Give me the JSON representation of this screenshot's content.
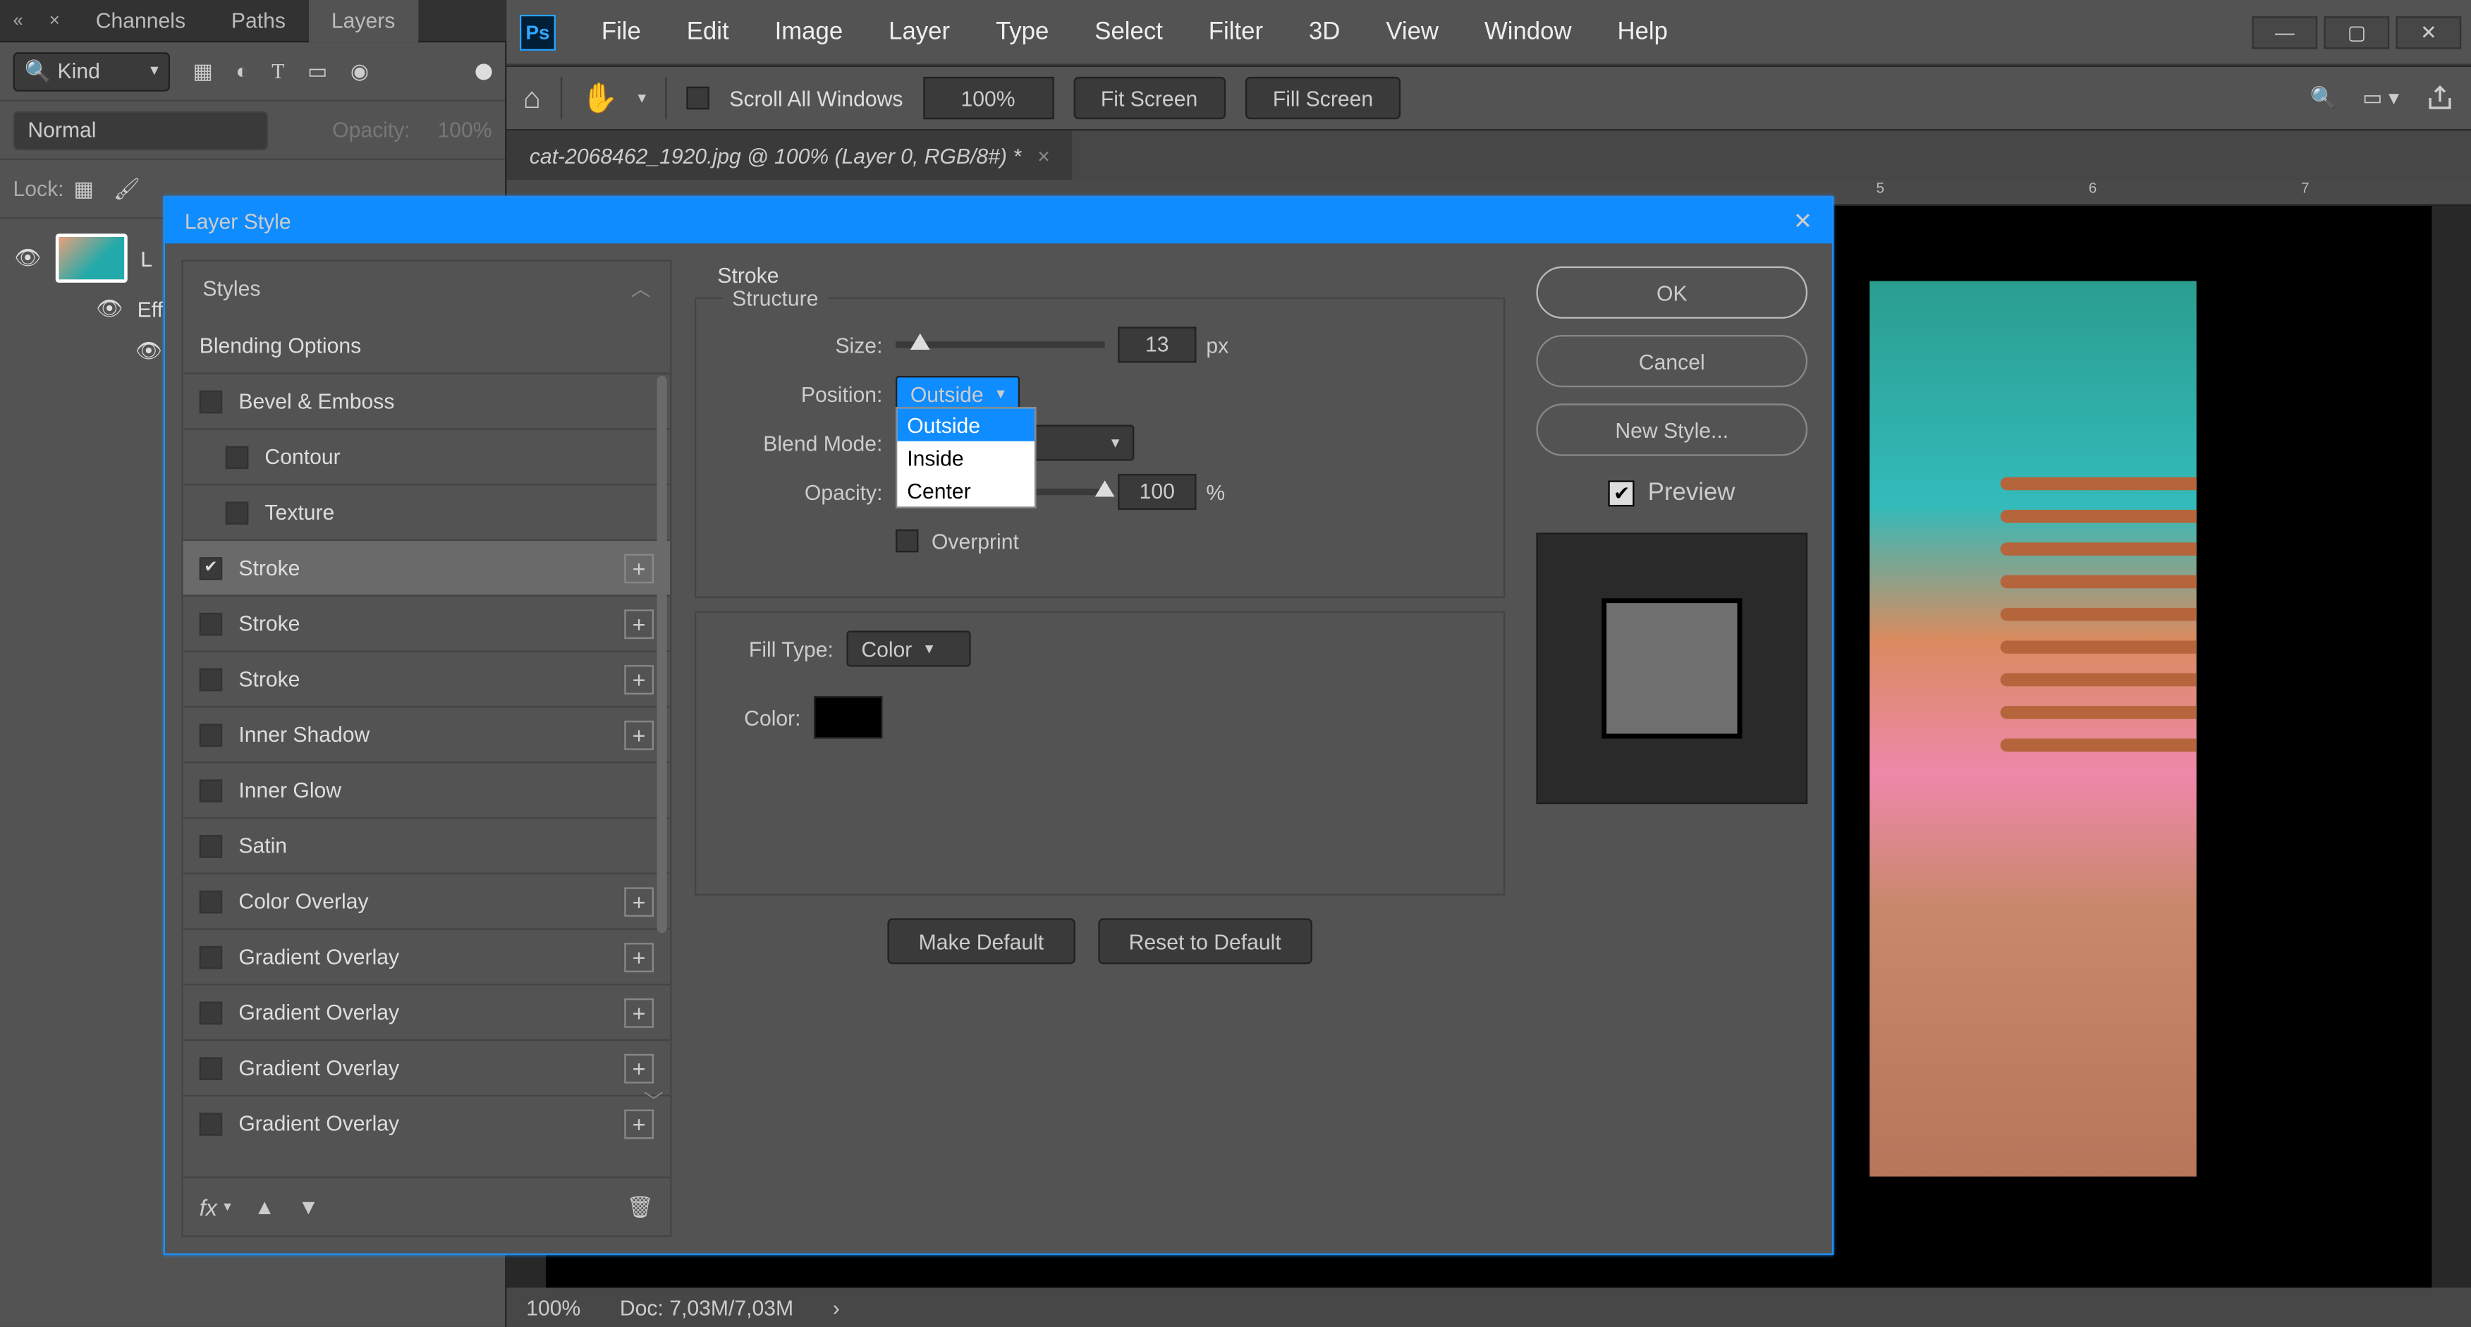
{
  "panel": {
    "tabs": [
      "Channels",
      "Paths",
      "Layers"
    ],
    "active_tab": 2,
    "kind_label": "Kind",
    "blend_mode": "Normal",
    "opacity_label": "Opacity:",
    "opacity_value": "100%",
    "lock_label": "Lock:",
    "layer0": "L",
    "effects_label": "Eff"
  },
  "menu": {
    "items": [
      "File",
      "Edit",
      "Image",
      "Layer",
      "Type",
      "Select",
      "Filter",
      "3D",
      "View",
      "Window",
      "Help"
    ]
  },
  "options": {
    "scroll_all": "Scroll All Windows",
    "zoom": "100%",
    "fit": "Fit Screen",
    "fill": "Fill Screen"
  },
  "document": {
    "tab_title": "cat-2068462_1920.jpg @ 100% (Layer 0, RGB/8#) *"
  },
  "ruler": {
    "ticks": [
      "5",
      "6",
      "7"
    ],
    "positions": [
      838,
      968,
      1098
    ]
  },
  "status": {
    "zoom": "100%",
    "doc": "Doc: 7,03M/7,03M"
  },
  "dialog": {
    "title": "Layer Style",
    "styles_header": "Styles",
    "blending_options": "Blending Options",
    "style_items": [
      {
        "label": "Bevel & Emboss",
        "checked": false,
        "plus": false,
        "indent": false
      },
      {
        "label": "Contour",
        "checked": false,
        "plus": false,
        "indent": true
      },
      {
        "label": "Texture",
        "checked": false,
        "plus": false,
        "indent": true
      },
      {
        "label": "Stroke",
        "checked": true,
        "plus": true,
        "indent": false,
        "selected": true
      },
      {
        "label": "Stroke",
        "checked": false,
        "plus": true,
        "indent": false
      },
      {
        "label": "Stroke",
        "checked": false,
        "plus": true,
        "indent": false
      },
      {
        "label": "Inner Shadow",
        "checked": false,
        "plus": true,
        "indent": false
      },
      {
        "label": "Inner Glow",
        "checked": false,
        "plus": false,
        "indent": false
      },
      {
        "label": "Satin",
        "checked": false,
        "plus": false,
        "indent": false
      },
      {
        "label": "Color Overlay",
        "checked": false,
        "plus": true,
        "indent": false
      },
      {
        "label": "Gradient Overlay",
        "checked": false,
        "plus": true,
        "indent": false
      },
      {
        "label": "Gradient Overlay",
        "checked": false,
        "plus": true,
        "indent": false
      },
      {
        "label": "Gradient Overlay",
        "checked": false,
        "plus": true,
        "indent": false
      },
      {
        "label": "Gradient Overlay",
        "checked": false,
        "plus": true,
        "indent": false
      }
    ],
    "footer_fx": "fx",
    "settings": {
      "heading": "Stroke",
      "structure": "Structure",
      "size_label": "Size:",
      "size_value": "13",
      "size_unit": "px",
      "position_label": "Position:",
      "position_value": "Outside",
      "position_options": [
        "Outside",
        "Inside",
        "Center"
      ],
      "blend_label": "Blend Mode:",
      "opacity_label": "Opacity:",
      "opacity_value": "100",
      "opacity_unit": "%",
      "overprint": "Overprint",
      "fill_type_label": "Fill Type:",
      "fill_type_value": "Color",
      "color_label": "Color:",
      "make_default": "Make Default",
      "reset_default": "Reset to Default"
    },
    "actions": {
      "ok": "OK",
      "cancel": "Cancel",
      "new_style": "New Style...",
      "preview": "Preview"
    }
  }
}
